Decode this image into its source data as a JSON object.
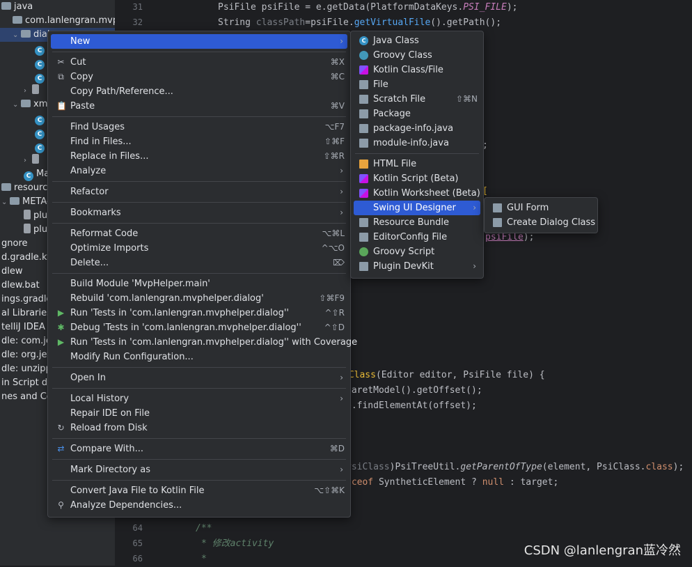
{
  "tree": [
    {
      "label": "java",
      "indent": 0,
      "icon": "folder",
      "arrow": ""
    },
    {
      "label": "com.lanlengran.mvphe",
      "indent": 1,
      "icon": "folder",
      "arrow": ""
    },
    {
      "label": "dial",
      "indent": 1,
      "icon": "folder",
      "arrow": "down",
      "selected": true
    },
    {
      "label": "",
      "indent": 3,
      "icon": "class"
    },
    {
      "label": "",
      "indent": 3,
      "icon": "class"
    },
    {
      "label": "",
      "indent": 3,
      "icon": "class"
    },
    {
      "label": "",
      "indent": 2,
      "icon": "file",
      "arrow": "right"
    },
    {
      "label": "xml",
      "indent": 1,
      "icon": "folder",
      "arrow": "down"
    },
    {
      "label": "",
      "indent": 3,
      "icon": "class"
    },
    {
      "label": "",
      "indent": 3,
      "icon": "class"
    },
    {
      "label": "",
      "indent": 3,
      "icon": "class"
    },
    {
      "label": "",
      "indent": 2,
      "icon": "file",
      "arrow": "right"
    },
    {
      "label": "Mai",
      "indent": 2,
      "icon": "class"
    },
    {
      "label": "resources",
      "indent": 0,
      "icon": "folder"
    },
    {
      "label": "META-",
      "indent": 0,
      "icon": "folder",
      "arrow": "down"
    },
    {
      "label": "plu",
      "indent": 2,
      "icon": "file"
    },
    {
      "label": "plu",
      "indent": 2,
      "icon": "file"
    },
    {
      "label": "gnore",
      "indent": 0
    },
    {
      "label": "d.gradle.kts",
      "indent": 0
    },
    {
      "label": "dlew",
      "indent": 0
    },
    {
      "label": "dlew.bat",
      "indent": 0
    },
    {
      "label": "ings.gradle",
      "indent": 0
    },
    {
      "label": "al Libraries",
      "indent": 0
    },
    {
      "label": "telliJ IDEA C",
      "indent": 0
    },
    {
      "label": "dle: com.jet",
      "indent": 0
    },
    {
      "label": "dle: org.jetb",
      "indent": 0
    },
    {
      "label": "dle: unzippe",
      "indent": 0
    },
    {
      "label": "in Script de",
      "indent": 0
    },
    {
      "label": "nes and Co",
      "indent": 0
    }
  ],
  "line_numbers": {
    "top": [
      "31",
      "32"
    ],
    "bottom": [
      "64",
      "65",
      "66"
    ]
  },
  "code_fragments": {
    "l31_a": "PsiFile psiFile = e.getData(PlatformDataKeys.",
    "l31_b": "PSI_FILE",
    "l31_c": ");",
    "l32_a": "String ",
    "l32_b": "classPath",
    "l32_c": "=psiFile.",
    "l32_d": "getVirtualFile",
    "l32_e": "().getPath();",
    "semi": ";",
    "bracket": "[",
    "psi_a": "psiFile",
    "psi_b": ");",
    "cls_a": "tClass",
    "cls_b": "(Editor editor, PsiFile file) {",
    "caret": "caretModel().getOffset();",
    "find": "e.findElementAt(offset);",
    "pt_a": "PsiClass",
    "pt_b": ")PsiTreeUtil.",
    "pt_c": "getParentOfType",
    "pt_d": "(element, PsiClass.",
    "pt_e": "class",
    "pt_f": ");",
    "inst_a": "nceof",
    "inst_b": " SyntheticElement ? ",
    "inst_c": "null",
    "inst_d": " : target;",
    "brace": "}",
    "doc1": "/**",
    "doc2": "* 修改activity",
    "doc3": "*"
  },
  "context_menu": {
    "items": [
      {
        "type": "item",
        "label": "New",
        "submenu": true,
        "highlight": true
      },
      {
        "type": "sep"
      },
      {
        "type": "item",
        "label": "Cut",
        "shortcut": "⌘X",
        "icon": "✂"
      },
      {
        "type": "item",
        "label": "Copy",
        "shortcut": "⌘C",
        "icon": "⧉"
      },
      {
        "type": "item",
        "label": "Copy Path/Reference..."
      },
      {
        "type": "item",
        "label": "Paste",
        "shortcut": "⌘V",
        "icon": "📋"
      },
      {
        "type": "sep"
      },
      {
        "type": "item",
        "label": "Find Usages",
        "shortcut": "⌥F7"
      },
      {
        "type": "item",
        "label": "Find in Files...",
        "shortcut": "⇧⌘F"
      },
      {
        "type": "item",
        "label": "Replace in Files...",
        "shortcut": "⇧⌘R"
      },
      {
        "type": "item",
        "label": "Analyze",
        "submenu": true
      },
      {
        "type": "sep"
      },
      {
        "type": "item",
        "label": "Refactor",
        "submenu": true
      },
      {
        "type": "sep"
      },
      {
        "type": "item",
        "label": "Bookmarks",
        "submenu": true
      },
      {
        "type": "sep"
      },
      {
        "type": "item",
        "label": "Reformat Code",
        "shortcut": "⌥⌘L"
      },
      {
        "type": "item",
        "label": "Optimize Imports",
        "shortcut": "^⌥O"
      },
      {
        "type": "item",
        "label": "Delete...",
        "shortcut": "⌦"
      },
      {
        "type": "sep"
      },
      {
        "type": "item",
        "label": "Build Module 'MvpHelper.main'"
      },
      {
        "type": "item",
        "label": "Rebuild 'com.lanlengran.mvphelper.dialog'",
        "shortcut": "⇧⌘F9"
      },
      {
        "type": "item",
        "label": "Run 'Tests in 'com.lanlengran.mvphelper.dialog''",
        "shortcut": "^⇧R",
        "icon": "▶",
        "icon_color": "#5fb865"
      },
      {
        "type": "item",
        "label": "Debug 'Tests in 'com.lanlengran.mvphelper.dialog''",
        "shortcut": "^⇧D",
        "icon": "✱",
        "icon_color": "#5fb865"
      },
      {
        "type": "item",
        "label": "Run 'Tests in 'com.lanlengran.mvphelper.dialog'' with Coverage",
        "icon": "▶",
        "icon_color": "#5fb865"
      },
      {
        "type": "item",
        "label": "Modify Run Configuration..."
      },
      {
        "type": "sep"
      },
      {
        "type": "item",
        "label": "Open In",
        "submenu": true
      },
      {
        "type": "sep"
      },
      {
        "type": "item",
        "label": "Local History",
        "submenu": true
      },
      {
        "type": "item",
        "label": "Repair IDE on File"
      },
      {
        "type": "item",
        "label": "Reload from Disk",
        "icon": "↻"
      },
      {
        "type": "sep"
      },
      {
        "type": "item",
        "label": "Compare With...",
        "shortcut": "⌘D",
        "icon": "⇄",
        "icon_color": "#4a8fe7"
      },
      {
        "type": "sep"
      },
      {
        "type": "item",
        "label": "Mark Directory as",
        "submenu": true
      },
      {
        "type": "sep"
      },
      {
        "type": "item",
        "label": "Convert Java File to Kotlin File",
        "shortcut": "⌥⇧⌘K"
      },
      {
        "type": "item",
        "label": "Analyze Dependencies...",
        "icon": "⚲"
      }
    ]
  },
  "new_submenu": {
    "items": [
      {
        "type": "item",
        "label": "Java Class",
        "icon": "c"
      },
      {
        "type": "item",
        "label": "Groovy Class",
        "icon": "g"
      },
      {
        "type": "item",
        "label": "Kotlin Class/File",
        "icon": "k"
      },
      {
        "type": "item",
        "label": "File",
        "icon": "f"
      },
      {
        "type": "item",
        "label": "Scratch File",
        "shortcut": "⇧⌘N",
        "icon": "f"
      },
      {
        "type": "item",
        "label": "Package",
        "icon": "f"
      },
      {
        "type": "item",
        "label": "package-info.java",
        "icon": "f"
      },
      {
        "type": "item",
        "label": "module-info.java",
        "icon": "f"
      },
      {
        "type": "sep"
      },
      {
        "type": "item",
        "label": "HTML File",
        "icon": "h"
      },
      {
        "type": "item",
        "label": "Kotlin Script (Beta)",
        "icon": "k"
      },
      {
        "type": "item",
        "label": "Kotlin Worksheet (Beta)",
        "icon": "k"
      },
      {
        "type": "item",
        "label": "Swing UI Designer",
        "submenu": true,
        "highlight": true
      },
      {
        "type": "item",
        "label": "Resource Bundle",
        "icon": "f"
      },
      {
        "type": "item",
        "label": "EditorConfig File",
        "icon": "f"
      },
      {
        "type": "item",
        "label": "Groovy Script",
        "icon": "gr2"
      },
      {
        "type": "item",
        "label": "Plugin DevKit",
        "submenu": true,
        "icon": "f"
      }
    ]
  },
  "swing_submenu": {
    "items": [
      {
        "type": "item",
        "label": "GUI Form",
        "icon": "f"
      },
      {
        "type": "item",
        "label": "Create Dialog Class",
        "icon": "f"
      }
    ]
  },
  "watermark": "CSDN @lanlengran蓝冷然"
}
